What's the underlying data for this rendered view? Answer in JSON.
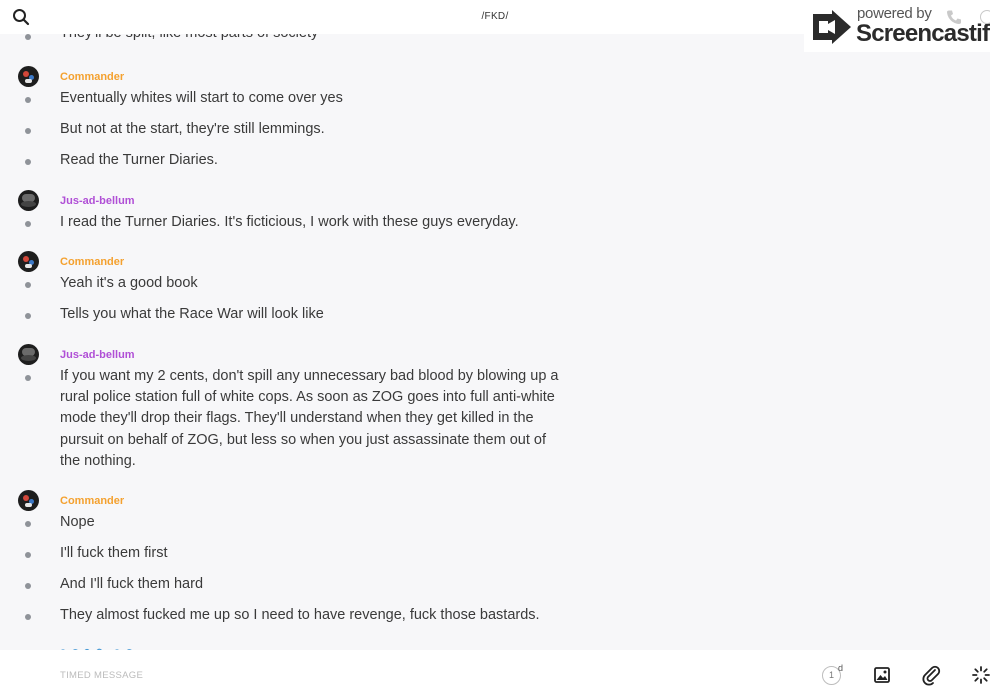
{
  "header": {
    "chat_title": "/FKD/",
    "search_icon": "search-icon"
  },
  "watermark": {
    "powered_by": "powered by",
    "brand": "Screencastify"
  },
  "messages": {
    "pre": {
      "text": "They'll be split, like most parts of society"
    },
    "g1": {
      "author": "Commander",
      "lines": [
        "Eventually whites will start to come over yes",
        "But not at the start, they're still lemmings.",
        "Read the Turner Diaries."
      ]
    },
    "g2": {
      "author": "Jus-ad-bellum",
      "lines": [
        "I read the Turner Diaries. It's ficticious, I work with these guys everyday."
      ]
    },
    "g3": {
      "author": "Commander",
      "lines": [
        "Yeah it's a good book",
        "Tells you what the Race War will look like"
      ]
    },
    "g4": {
      "author": "Jus-ad-bellum",
      "lines": [
        "If you want my 2 cents, don't spill any unnecessary bad blood by blowing up a rural police station full of white cops. As soon as ZOG goes into full anti-white mode they'll drop their flags. They'll understand when they get killed in the pursuit on behalf of ZOG, but less so when you just assassinate them out of the nothing."
      ]
    },
    "g5": {
      "author": "Commander",
      "lines": [
        "Nope",
        "I'll fuck them first",
        "And I'll fuck them hard",
        "They almost fucked me up so I need to have revenge, fuck those bastards."
      ]
    }
  },
  "composer": {
    "placeholder": "TIMED MESSAGE",
    "timer_value": "1",
    "timer_unit": "d"
  },
  "colors": {
    "commander": "#f4a12f",
    "jus_ad_bellum": "#b04fd6",
    "background": "#f7f7f9"
  }
}
